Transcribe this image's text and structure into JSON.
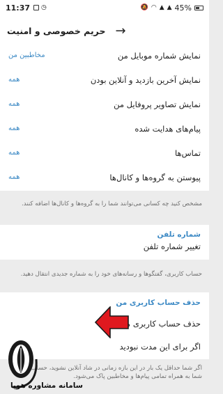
{
  "status_bar": {
    "time": "11:37",
    "battery": "45%"
  },
  "header": {
    "title": "حریم خصوصی و امنیت"
  },
  "privacy": {
    "items": [
      {
        "label": "نمایش شماره موبایل من",
        "value": "مخاطبین من"
      },
      {
        "label": "نمایش آخرین بازدید و آنلاین بودن",
        "value": "همه"
      },
      {
        "label": "نمایش تصاویر پروفایل من",
        "value": "همه"
      },
      {
        "label": "پیام‌های هدایت شده",
        "value": "همه"
      },
      {
        "label": "تماس‌ها",
        "value": "همه"
      },
      {
        "label": "پیوستن به گروه‌ها و کانال‌ها",
        "value": "همه"
      }
    ],
    "note": "مشخص کنید چه کسانی می‌توانند شما را به گروه‌ها و کانال‌ها اضافه کنند."
  },
  "phone": {
    "title": "شماره تلفن",
    "change_label": "تغییر شماره تلفن",
    "note": "حساب کاربری، گفتگوها و رسانه‌های خود را به شماره جدیدی انتقال دهید."
  },
  "delete": {
    "title": "حذف حساب کاربری من",
    "delete_label": "حذف حساب کاربری من",
    "inactive_label": "اگر برای این مدت نبودید",
    "note_line1": "اگر شما حداقل یک بار در این بازه زمانی در شاد آنلاین نشوید، حساب کاربری",
    "note_line2": "شما به همراه تمامی پیام‌ها و مخاطبین پاک می‌شود."
  },
  "watermark": {
    "text": "سامانه مشاوره هوپا"
  },
  "colors": {
    "accent": "#3d8ac5",
    "arrow": "#e0191f",
    "background": "#ececec"
  }
}
